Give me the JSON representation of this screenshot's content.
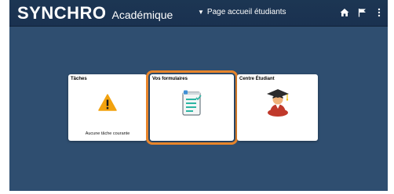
{
  "header": {
    "brand": "SYNCHRO",
    "subtitle": "Académique",
    "home_menu_label": "Page accueil étudiants",
    "icons": [
      "home-icon",
      "flag-icon",
      "more-vertical-icon"
    ]
  },
  "tiles": [
    {
      "title": "Tâches",
      "footer": "Aucune tâche courante",
      "icon": "warning-icon"
    },
    {
      "title": "Vos formulaires",
      "footer": "",
      "icon": "form-document-icon",
      "highlighted": true
    },
    {
      "title": "Centre Étudiant",
      "footer": "",
      "icon": "graduate-icon"
    }
  ],
  "colors": {
    "header_bg": "#1c3653",
    "page_bg": "#2f4e70",
    "highlight": "#e8852b",
    "warning": "#f2a20f"
  }
}
